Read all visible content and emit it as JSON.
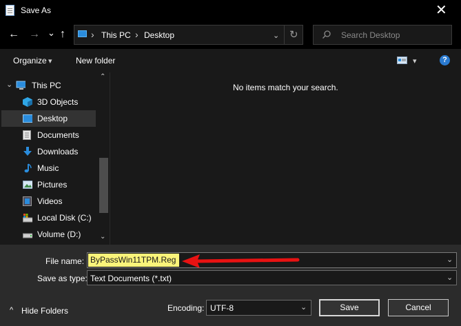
{
  "window": {
    "title": "Save As",
    "close_glyph": "✕"
  },
  "nav": {
    "back": "←",
    "forward": "→",
    "recent": "⌄",
    "up": "↑",
    "breadcrumb": [
      "This PC",
      "Desktop"
    ],
    "separator": "›",
    "refresh": "↻",
    "search_placeholder": "Search Desktop"
  },
  "toolbar": {
    "organize": "Organize",
    "new_folder": "New folder",
    "help": "?"
  },
  "sidebar": {
    "items": [
      {
        "label": "This PC",
        "icon": "this-pc-icon"
      },
      {
        "label": "3D Objects",
        "icon": "3d-objects-icon"
      },
      {
        "label": "Desktop",
        "icon": "desktop-icon",
        "selected": true
      },
      {
        "label": "Documents",
        "icon": "documents-icon"
      },
      {
        "label": "Downloads",
        "icon": "downloads-icon"
      },
      {
        "label": "Music",
        "icon": "music-icon"
      },
      {
        "label": "Pictures",
        "icon": "pictures-icon"
      },
      {
        "label": "Videos",
        "icon": "videos-icon"
      },
      {
        "label": "Local Disk (C:)",
        "icon": "local-disk-icon"
      },
      {
        "label": "Volume (D:)",
        "icon": "volume-icon"
      }
    ]
  },
  "content": {
    "empty_message": "No items match your search."
  },
  "form": {
    "file_name_label": "File name:",
    "file_name_value": "ByPassWin11TPM.Reg",
    "save_as_type_label": "Save as type:",
    "save_as_type_value": "Text Documents (*.txt)",
    "encoding_label": "Encoding:",
    "encoding_value": "UTF-8",
    "hide_folders": "Hide Folders"
  },
  "buttons": {
    "save": "Save",
    "cancel": "Cancel"
  },
  "colors": {
    "accent": "#2a8cdc",
    "highlight": "#fbf47a",
    "annotation_arrow": "#e81212"
  }
}
